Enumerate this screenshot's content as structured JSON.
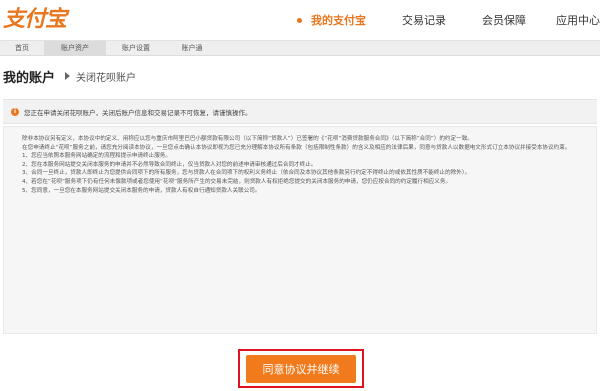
{
  "brand": {
    "logo_text": "支付宝"
  },
  "topnav": {
    "items": [
      "我的支付宝",
      "交易记录",
      "会员保障",
      "应用中心"
    ]
  },
  "subnav": {
    "items": [
      "首页",
      "账户资产",
      "账户设置",
      "账户通"
    ],
    "active_index": 1
  },
  "breadcrumb": {
    "title": "我的账户",
    "current": "关闭花呗账户"
  },
  "notice": {
    "icon": "info-icon",
    "text": "您正在申请关闭花呗账户，关闭后账户信息和交易记录不可恢复，请谨慎操作。"
  },
  "agreement": {
    "paragraphs": [
      "除非本协议另有定义，本协议中的定义、用称应以您与重庆市阿里巴巴小额贷款有限公司（以下简称“贷款人”）已签署的《“花呗”消费贷款服务合同》（以下简称“合同”）的约定一致。",
      "在您申请终止“花呗”服务之前，请您充分阅读本协议，一旦您点击确认本协议即视为您已充分理解本协议所有条款（包括限制性条款）的含义及相应的法律后果，同意与贷款人以数据电文形式订立本协议并接受本协议约束。",
      "1、您应当依照本服务网站确定的流程和提示申请终止服务。",
      "2、您在本服务网站提交关闭本服务的申请并不必然导致合同终止，仅当贷款人对您的前述申请审核通过后合同才终止。",
      "3、合同一旦终止，贷款人即终止为您提供合同项下的所有服务，您与贷款人在合同项下的权利义务终止（依合同及本协议其他条款另行约定不得终止的或依其性质不能终止的除外）。",
      "4、若您在“花呗”服务项下仍有任何未偿款项或者您使用“花呗”服务所产生的交易未完结，则贷款人有权拒绝您提交的关闭本服务的申请，您仍应按合同的约定履行相应义务。",
      "5、您同意，一旦您在本服务网站提交关闭本服务的申请，贷款人有权自行通知贷款人关联公司。"
    ]
  },
  "button": {
    "label": "同意协议并继续",
    "frame_color": "#e0141e",
    "fill_color": "#f07a1c"
  },
  "colors": {
    "accent": "#e8771f"
  }
}
